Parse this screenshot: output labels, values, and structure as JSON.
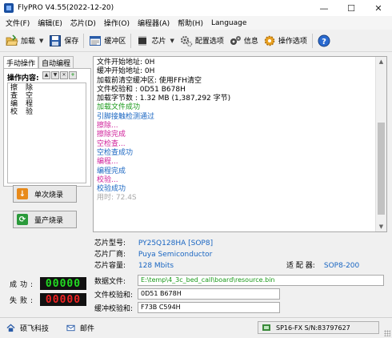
{
  "window": {
    "title": "FlyPRO V4.55(2022-12-20)",
    "minimize": "—",
    "maximize": "☐",
    "close": "✕"
  },
  "menu": [
    "文件(F)",
    "编辑(E)",
    "芯片(D)",
    "操作(O)",
    "编程器(A)",
    "帮助(H)",
    "Language"
  ],
  "toolbar": {
    "load": "加载",
    "save": "保存",
    "buffer": "缓冲区",
    "chip": "芯片",
    "config": "配置选项",
    "info": "信息",
    "options": "操作选项"
  },
  "left": {
    "tab_manual": "手动操作",
    "tab_auto": "自动编程",
    "ops_label": "操作内容:",
    "operations": [
      "擦除",
      "查空",
      "编程",
      "校验"
    ],
    "single_burn": "单次烧录",
    "batch_burn": "量产烧录",
    "success_label": "成功:",
    "fail_label": "失败:",
    "success_count": "00000",
    "fail_count": "00000",
    "success_color": "#22dd22",
    "fail_color": "#ee2222"
  },
  "log": [
    {
      "text": "文件开始地址: 0H",
      "color": "#000000"
    },
    {
      "text": "缓冲开始地址: 0H",
      "color": "#000000"
    },
    {
      "text": "加载前清空缓冲区: 使用FFH清空",
      "color": "#000000"
    },
    {
      "text": "文件校验和    : 0D51 B678H",
      "color": "#000000"
    },
    {
      "text": "加载字节数    : 1.32 MB (1,387,292 字节)",
      "color": "#000000"
    },
    {
      "text": "加载文件成功",
      "color": "#1a9a1a"
    },
    {
      "text": "引脚接触检测通过",
      "color": "#1a66c2"
    },
    {
      "text": "擦除...",
      "color": "#d0209a"
    },
    {
      "text": "擦除完成",
      "color": "#d0209a"
    },
    {
      "text": "空检查...",
      "color": "#d0209a"
    },
    {
      "text": "空检查成功",
      "color": "#1a66c2"
    },
    {
      "text": "编程...",
      "color": "#d0209a"
    },
    {
      "text": "编程完成",
      "color": "#1a66c2"
    },
    {
      "text": "校验...",
      "color": "#d0209a"
    },
    {
      "text": "校验成功",
      "color": "#1a66c2"
    },
    {
      "text": "用时: 72.4S",
      "color": "#a8a8a8"
    }
  ],
  "chip": {
    "model_label": "芯片型号:",
    "model": "PY25Q128HA [SOP8]",
    "vendor_label": "芯片厂商:",
    "vendor": "Puya Semiconductor",
    "capacity_label": "芯片容量:",
    "capacity": "128 Mbits",
    "adapter_label": "适 配 器:",
    "adapter": "SOP8-200"
  },
  "files": {
    "data_label": "数据文件:",
    "data_path": "E:\\temp\\4_3c_bed_call\\board\\resource.bin",
    "file_checksum_label": "文件校验和:",
    "file_checksum": "0D51 B678H",
    "buffer_checksum_label": "缓冲校验和:",
    "buffer_checksum": "F73B C594H"
  },
  "status": {
    "company": "硕飞科技",
    "mail": "邮件",
    "device": "SP16-FX  S/N:83797627"
  },
  "colors": {
    "accent_blue": "#1a66c2",
    "success_green": "#1a9a1a",
    "action_pink": "#d0209a"
  }
}
